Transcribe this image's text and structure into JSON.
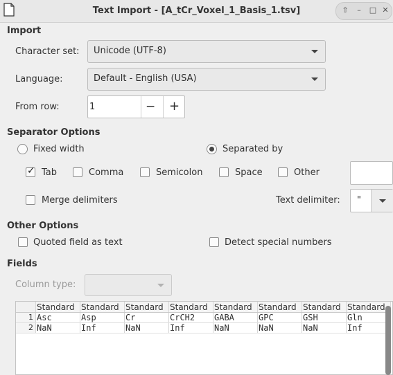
{
  "window": {
    "title": "Text Import - [A_tCr_Voxel_1_Basis_1.tsv]",
    "controls": [
      "⇧",
      "–",
      "□",
      "✕"
    ]
  },
  "import": {
    "heading": "Import",
    "charset_label": "Character set:",
    "charset_value": "Unicode (UTF-8)",
    "language_label": "Language:",
    "language_value": "Default - English (USA)",
    "from_row_label": "From row:",
    "from_row_value": "1",
    "minus": "−",
    "plus": "+"
  },
  "separator": {
    "heading": "Separator Options",
    "fixed_width": "Fixed width",
    "separated_by": "Separated by",
    "separated_by_selected": true,
    "tab": "Tab",
    "tab_checked": true,
    "comma": "Comma",
    "semicolon": "Semicolon",
    "space": "Space",
    "other": "Other",
    "other_value": "",
    "merge": "Merge delimiters",
    "text_delim_label": "Text delimiter:",
    "text_delim_value": "\""
  },
  "other_options": {
    "heading": "Other Options",
    "quoted": "Quoted field as text",
    "detect": "Detect special numbers"
  },
  "fields": {
    "heading": "Fields",
    "column_type_label": "Column type:",
    "column_type_value": "",
    "headers": [
      "Standard",
      "Standard",
      "Standard",
      "Standard",
      "Standard",
      "Standard",
      "Standard",
      "Standard"
    ],
    "rows": [
      {
        "num": "1",
        "cells": [
          "Asc",
          "Asp",
          "Cr",
          "CrCH2",
          "GABA",
          "GPC",
          "GSH",
          "Gln"
        ]
      },
      {
        "num": "2",
        "cells": [
          "NaN",
          "Inf",
          "NaN",
          "Inf",
          "NaN",
          "NaN",
          "NaN",
          "Inf"
        ]
      }
    ]
  }
}
